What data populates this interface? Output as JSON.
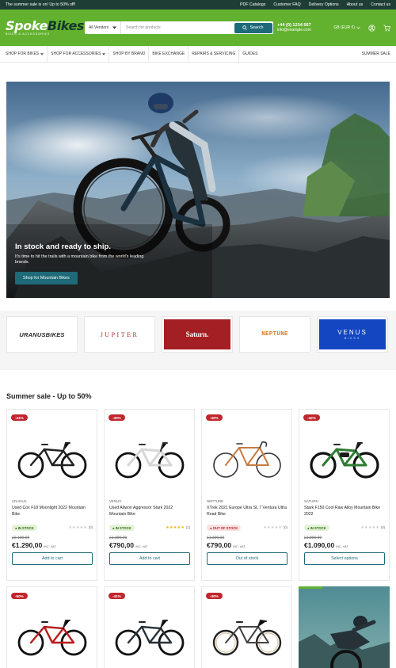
{
  "announcement": {
    "text": "The summer sale is on! Up to 50% off!",
    "links": [
      "PDF Catalogs",
      "Customer FAQ",
      "Delivery Options",
      "About us",
      "Contact us"
    ]
  },
  "header": {
    "logo_main_a": "Spoke",
    "logo_main_b": "Bikes",
    "logo_sub": "BIKES & ACCESSORIES",
    "vendor_select": "All Vendors",
    "search_placeholder": "Search for products",
    "search_button": "Search",
    "phone": "+44 (0) 1234 567",
    "email": "info@example.com",
    "currency": "GB (EUR €)",
    "icons": [
      "chevron-down-icon",
      "user-icon",
      "cart-icon"
    ]
  },
  "nav": {
    "items": [
      "SHOP FOR BIKES",
      "SHOP FOR ACCESSORIES",
      "SHOP BY BRAND",
      "BIKE EXCHANGE",
      "REPAIRS & SERVICING",
      "GUIDES"
    ],
    "right": "SUMMER SALE"
  },
  "hero": {
    "title": "In stock and ready to ship.",
    "description": "It's time to hit the trails with a mountain bike from the world's leading brands.",
    "cta": "Shop for Mountain Bikes"
  },
  "brands": [
    "URANUSBIKES",
    "JUPITER",
    "Saturn.",
    "NEPTUNE",
    "VENUS",
    "BIKES"
  ],
  "sale_title": "Summer sale - Up to 50%",
  "products": [
    {
      "badge": "-41%",
      "vendor": "URANUS",
      "name": "Used Cox F18 Moonlight 2022 Mountain Bike",
      "stock": "IN STOCK",
      "rating_stars": "★★★★★",
      "rating_count": "(0)",
      "old_price": "£2.190,00",
      "price": "€1.290,00",
      "vat": "INC. VAT",
      "button": "Add to cart"
    },
    {
      "badge": "-30%",
      "vendor": "VENUS",
      "name": "Used Altwon Aggressor Stark 2022 Mountain Bike",
      "stock": "IN STOCK",
      "rating_stars": "★★★★★",
      "rating_count": "(1)",
      "old_price": "£1.390,00",
      "price": "€790,00",
      "vat": "INC. VAT",
      "button": "Add to cart"
    },
    {
      "badge": "-30%",
      "vendor": "NEPTUNE",
      "name": "XTrek 2021 Europe Ultra SL 7 Ventura Ultra Road Bike",
      "stock": "OUT OF STOCK",
      "rating_stars": "★★★★★",
      "rating_count": "(0)",
      "old_price": "£1.390,00",
      "price": "€790,00",
      "vat": "INC. VAT",
      "button": "Out of stock"
    },
    {
      "badge": "-42%",
      "vendor": "SATURN",
      "name": "Stark F150 Cool Raw Alloy Mountain Bike 2022",
      "stock": "IN STOCK",
      "rating_stars": "★★★★★",
      "rating_count": "(0)",
      "old_price": "£1.890,00",
      "price": "€1.090,00",
      "vat": "INC. VAT",
      "button": "Select options"
    }
  ],
  "products_row2": [
    {
      "badge": "-50%"
    },
    {
      "badge": "-41%"
    },
    {
      "badge": "-30%"
    }
  ],
  "colors": {
    "brand_green": "#62b22f",
    "dark_teal": "#1e3d35",
    "accent_teal": "#1e6a78",
    "sale_red": "#c0262d"
  }
}
